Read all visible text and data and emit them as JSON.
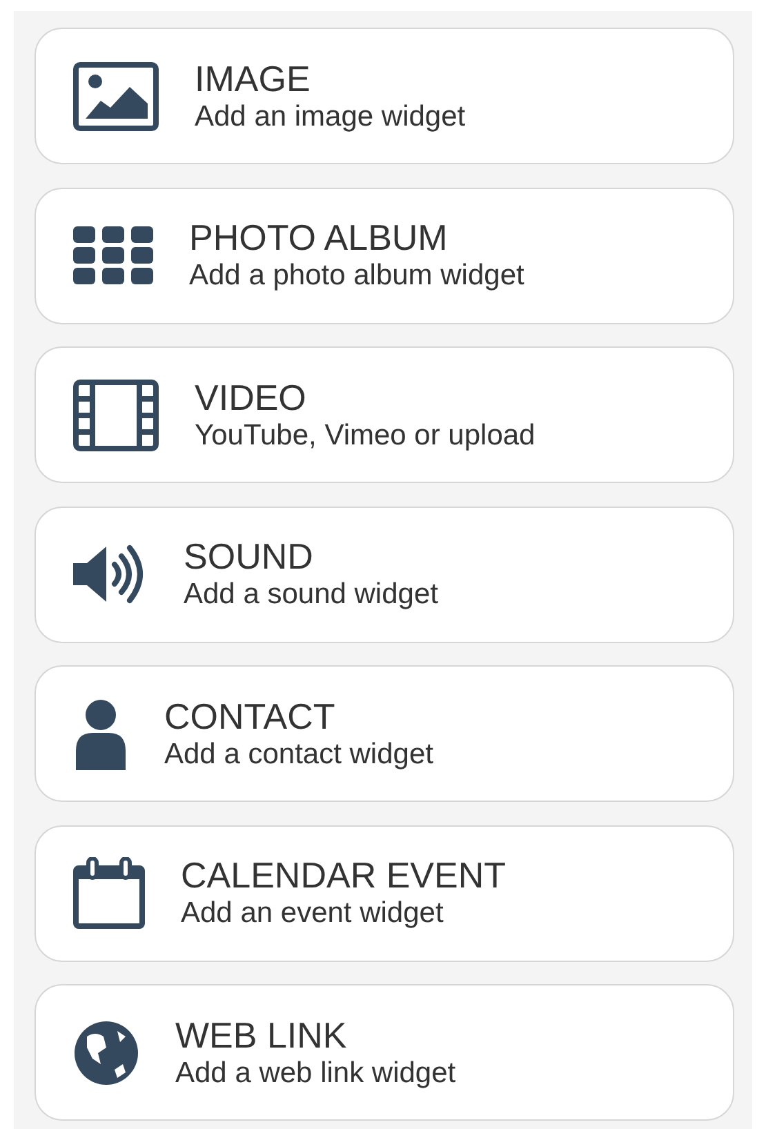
{
  "widgets": [
    {
      "kind": "image",
      "title": "IMAGE",
      "subtitle": "Add an image widget"
    },
    {
      "kind": "album",
      "title": "PHOTO ALBUM",
      "subtitle": "Add a photo album widget"
    },
    {
      "kind": "video",
      "title": "VIDEO",
      "subtitle": "YouTube, Vimeo or upload"
    },
    {
      "kind": "sound",
      "title": "SOUND",
      "subtitle": "Add a sound widget"
    },
    {
      "kind": "contact",
      "title": "CONTACT",
      "subtitle": "Add a contact widget"
    },
    {
      "kind": "calendar",
      "title": "CALENDAR EVENT",
      "subtitle": "Add an event widget"
    },
    {
      "kind": "link",
      "title": "WEB LINK",
      "subtitle": "Add a web link widget"
    }
  ]
}
